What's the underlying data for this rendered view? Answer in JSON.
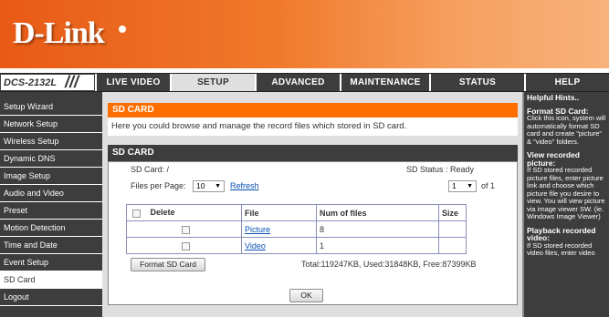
{
  "brand": {
    "logo": "D-Link",
    "model": "DCS-2132L",
    "slashes": "///"
  },
  "tabs": [
    "LIVE VIDEO",
    "SETUP",
    "ADVANCED",
    "MAINTENANCE",
    "STATUS",
    "HELP"
  ],
  "sidebar": {
    "items": [
      "Setup Wizard",
      "Network Setup",
      "Wireless Setup",
      "Dynamic DNS",
      "Image Setup",
      "Audio and Video",
      "Preset",
      "Motion Detection",
      "Time and Date",
      "Event Setup",
      "SD Card",
      "Logout"
    ]
  },
  "main": {
    "section_title": "SD CARD",
    "description": "Here you could browse and manage the record files which stored in SD card.",
    "panel_title": "SD CARD",
    "sd_card_path": "SD Card: /",
    "sd_status": "SD Status : Ready",
    "files_per_page_label": "Files per Page:",
    "files_per_page_value": "10",
    "refresh_label": "Refresh",
    "page_value": "1",
    "page_of": "of 1",
    "table": {
      "headers": [
        "Delete",
        "File",
        "Num of files",
        "Size"
      ],
      "rows": [
        {
          "file": "Picture",
          "num": "8",
          "size": ""
        },
        {
          "file": "Video",
          "num": "1",
          "size": ""
        }
      ]
    },
    "format_button": "Format SD Card",
    "totals": "Total:119247KB, Used:31848KB, Free:87399KB",
    "ok_button": "OK"
  },
  "hints": {
    "title": "Helpful Hints..",
    "items": [
      {
        "heading": "Format SD Card:",
        "text": "Click this icon, system will automatically format SD card and create \"picture\" & \"video\" folders."
      },
      {
        "heading": "View recorded picture:",
        "text": "If SD stored recorded picture files, enter picture link and choose which picture file you desire to view. You will view picture via image viewer SW. (ie. Windows Image Viewer)"
      },
      {
        "heading": "Playback recorded video:",
        "text": "If SD stored recorded video files, enter video"
      }
    ]
  },
  "colors": {
    "brand_orange": "#ff6f00",
    "nav_dark": "#3d3d3d",
    "link_blue": "#0a52b3"
  }
}
